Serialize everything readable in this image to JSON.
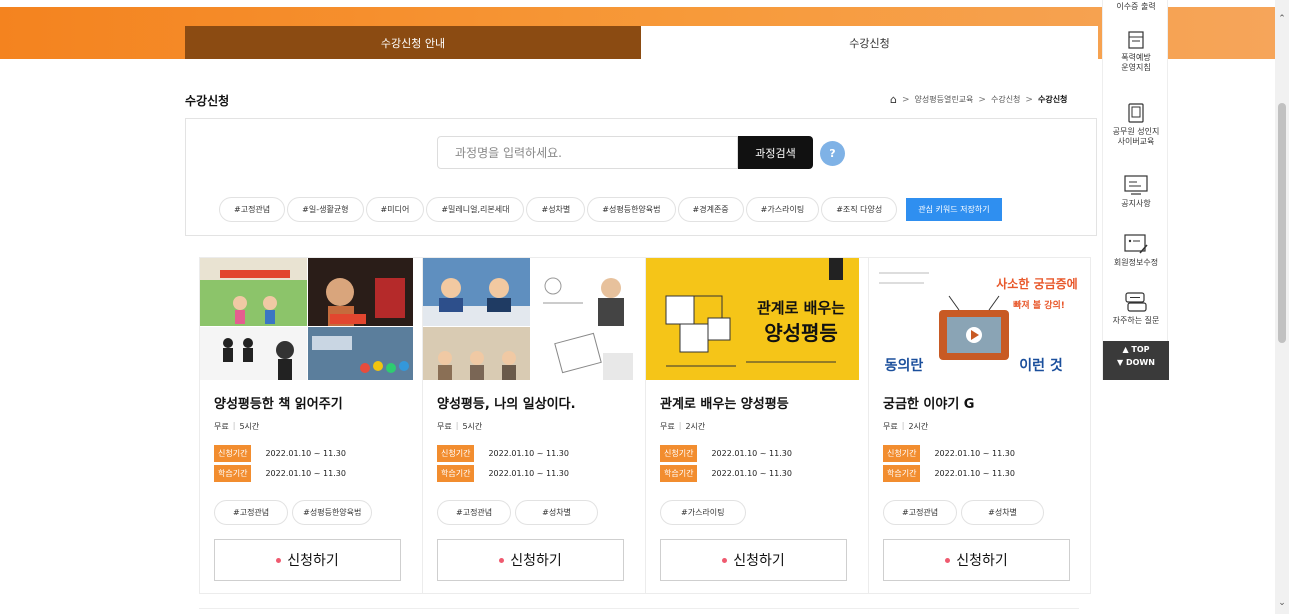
{
  "tabs": {
    "guide": "수강신청 안내",
    "apply": "수강신청"
  },
  "page": {
    "title": "수강신청"
  },
  "breadcrumb": {
    "home_icon": "home-icon",
    "items": [
      "양성평등열린교육",
      "수강신청",
      "수강신청"
    ]
  },
  "search": {
    "placeholder": "과정명을 입력하세요.",
    "button": "과정검색",
    "help": "?"
  },
  "keywords": [
    "#고정관념",
    "#일-생활균형",
    "#미디어",
    "#밀레니얼,리본세대",
    "#성차별",
    "#성평등한양육법",
    "#경계존중",
    "#가스라이팅",
    "#조직 다양성"
  ],
  "keyword_save": "관심 키워드 저장하기",
  "courses": [
    {
      "title": "양성평등한 책 읽어주기",
      "price": "무료",
      "hours": "5시간",
      "apply_label": "신청기간",
      "apply_period": "2022.01.10 ~ 11.30",
      "study_label": "학습기간",
      "study_period": "2022.01.10 ~ 11.30",
      "tags": [
        "#고정관념",
        "#성평등한양육법"
      ],
      "button": "신청하기"
    },
    {
      "title": "양성평등, 나의 일상이다.",
      "price": "무료",
      "hours": "5시간",
      "apply_label": "신청기간",
      "apply_period": "2022.01.10 ~ 11.30",
      "study_label": "학습기간",
      "study_period": "2022.01.10 ~ 11.30",
      "tags": [
        "#고정관념",
        "#성차별"
      ],
      "button": "신청하기"
    },
    {
      "title": "관계로 배우는 양성평등",
      "price": "무료",
      "hours": "2시간",
      "apply_label": "신청기간",
      "apply_period": "2022.01.10 ~ 11.30",
      "study_label": "학습기간",
      "study_period": "2022.01.10 ~ 11.30",
      "tags": [
        "#가스라이팅"
      ],
      "button": "신청하기",
      "thumb_text": [
        "관계로 배우는",
        "양성평등"
      ]
    },
    {
      "title": "궁금한 이야기 G",
      "price": "무료",
      "hours": "2시간",
      "apply_label": "신청기간",
      "apply_period": "2022.01.10 ~ 11.30",
      "study_label": "학습기간",
      "study_period": "2022.01.10 ~ 11.30",
      "tags": [
        "#고정관념",
        "#성차별"
      ],
      "button": "신청하기",
      "thumb_text": [
        "동의란",
        "이런 것",
        "사소한 궁금증에",
        "빠져 볼 강의!"
      ]
    }
  ],
  "quick_menu": {
    "partial_top": "이수증 출력",
    "items": [
      {
        "icon": "document-icon",
        "label_lines": [
          "폭력예방",
          "운영지침"
        ]
      },
      {
        "icon": "tablet-icon",
        "label_lines": [
          "공무원 성인지",
          "사이버교육"
        ]
      },
      {
        "icon": "monitor-icon",
        "label_lines": [
          "공지사항"
        ]
      },
      {
        "icon": "edit-profile-icon",
        "label_lines": [
          "회원정보수정"
        ]
      },
      {
        "icon": "faq-icon",
        "label_lines": [
          "자주하는 질문"
        ]
      }
    ],
    "top": "▲ TOP",
    "down": "▼ DOWN"
  },
  "colors": {
    "accent_orange": "#f4831f",
    "tab_brown": "#8b4b12",
    "label_orange": "#f28d2f",
    "save_blue": "#2f8ff0"
  }
}
